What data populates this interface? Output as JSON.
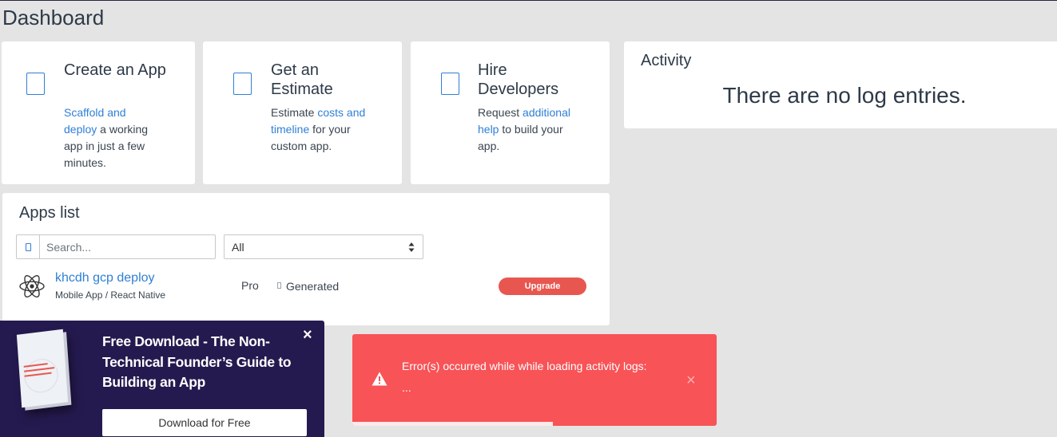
{
  "page": {
    "title": "Dashboard"
  },
  "cards": [
    {
      "title": "Create an App",
      "desc_link": "Scaffold and deploy",
      "desc_text": " a working app in just a few minutes."
    },
    {
      "title": "Get an Estimate",
      "desc_pre": "Estimate ",
      "desc_link": "costs and timeline",
      "desc_text": " for your custom app."
    },
    {
      "title": "Hire Developers",
      "desc_pre": "Request ",
      "desc_link": "additional help",
      "desc_text": " to build your app."
    }
  ],
  "activity": {
    "title": "Activity",
    "empty_message": "There are no log entries."
  },
  "apps": {
    "title": "Apps list",
    "search_placeholder": "Search...",
    "filter_value": "All",
    "rows": [
      {
        "name": "khcdh gcp deploy",
        "type": "Mobile App / React Native",
        "plan": "Pro",
        "status": "Generated",
        "action": "Upgrade"
      }
    ]
  },
  "promo": {
    "title": "Free Download - The Non-Technical Founder’s Guide to Building an App",
    "button": "Download for Free",
    "close": "×"
  },
  "toast": {
    "message": "Error(s) occurred while while loading activity logs:",
    "detail": "...",
    "close": "×",
    "progress": 0.55
  },
  "colors": {
    "accent": "#2f7fd6",
    "upgrade": "#e8574f",
    "toast": "#f85357",
    "promo": "#251a4f"
  }
}
